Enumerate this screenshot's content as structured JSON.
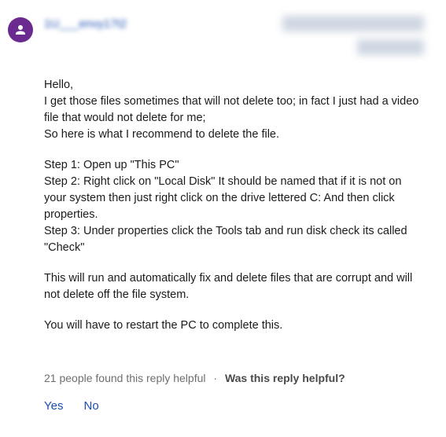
{
  "post": {
    "username": "1U___envy17t2",
    "body": {
      "greeting": "Hello,",
      "intro1": "I get those files sometimes that will not delete too; in fact I just had a video file that would not delete for me;",
      "intro2": "So here is what I recommend to delete the file.",
      "step1": "Step 1: Open up \"This PC\"",
      "step2": "Step 2: Right click on \"Local Disk\" It should be named that if it is not on your system then just right click on the drive lettered C:   And then click properties.",
      "step3": "Step 3: Under properties click the Tools tab and run disk check its called \"Check\"",
      "result": "This will run and automatically fix and delete files that are corrupt and will not delete off the file system.",
      "closing": "You will have to restart the PC to complete this."
    }
  },
  "footer": {
    "helpful_count_text": "21 people found this reply helpful",
    "separator": "·",
    "helpful_question": "Was this reply helpful?",
    "yes_label": "Yes",
    "no_label": "No"
  }
}
